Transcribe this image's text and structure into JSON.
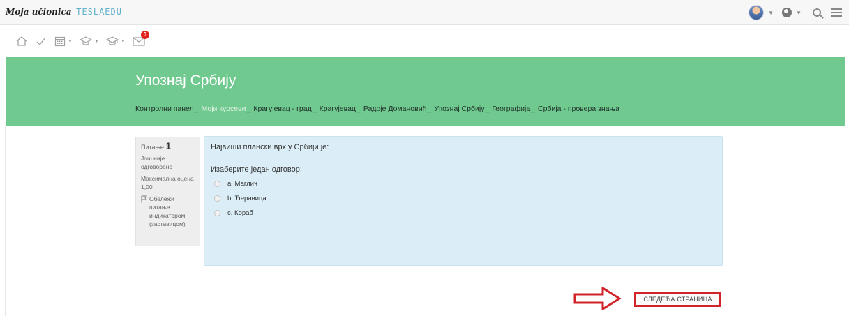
{
  "brand": {
    "script": "Moja učionica",
    "tesla": "TESLAEDU"
  },
  "top_right": {
    "avatar_icon": "user-avatar",
    "globe_icon": "globe-icon",
    "search_icon": "search-icon",
    "menu_icon": "hamburger-menu-icon"
  },
  "nav": {
    "icons": [
      "home-icon",
      "check-icon",
      "calendar-icon",
      "graduation-cap-icon",
      "graduation-cap-outline-icon",
      "envelope-icon"
    ],
    "messages_badge": "0"
  },
  "hero": {
    "title": "Упознај Србију",
    "breadcrumbs": [
      "Контролни панел",
      "Моји курсеви",
      "Крагујевац - град",
      "Крагујевац",
      "Радоје Домановић",
      "Упознај Србију",
      "Географија",
      "Србија - провера знања"
    ]
  },
  "question_info": {
    "label": "Питање",
    "number": "1",
    "status": "Још није одговорено",
    "max_grade": "Максимална оцена 1,00",
    "flag_label": "Обележи питање индикатором (заставицом)"
  },
  "question": {
    "text": "Највиши плански врх у Србији је:",
    "prompt": "Изаберите један одговор:",
    "answers": [
      "a. Маглич",
      "b. Ђеравица",
      "c. Кораб"
    ]
  },
  "next_button": {
    "label": "СЛЕДЕЋА СТРАНИЦА"
  },
  "colors": {
    "hero": "#70c98f",
    "question_bg": "#dbeef7",
    "highlight": "#d1232a"
  }
}
